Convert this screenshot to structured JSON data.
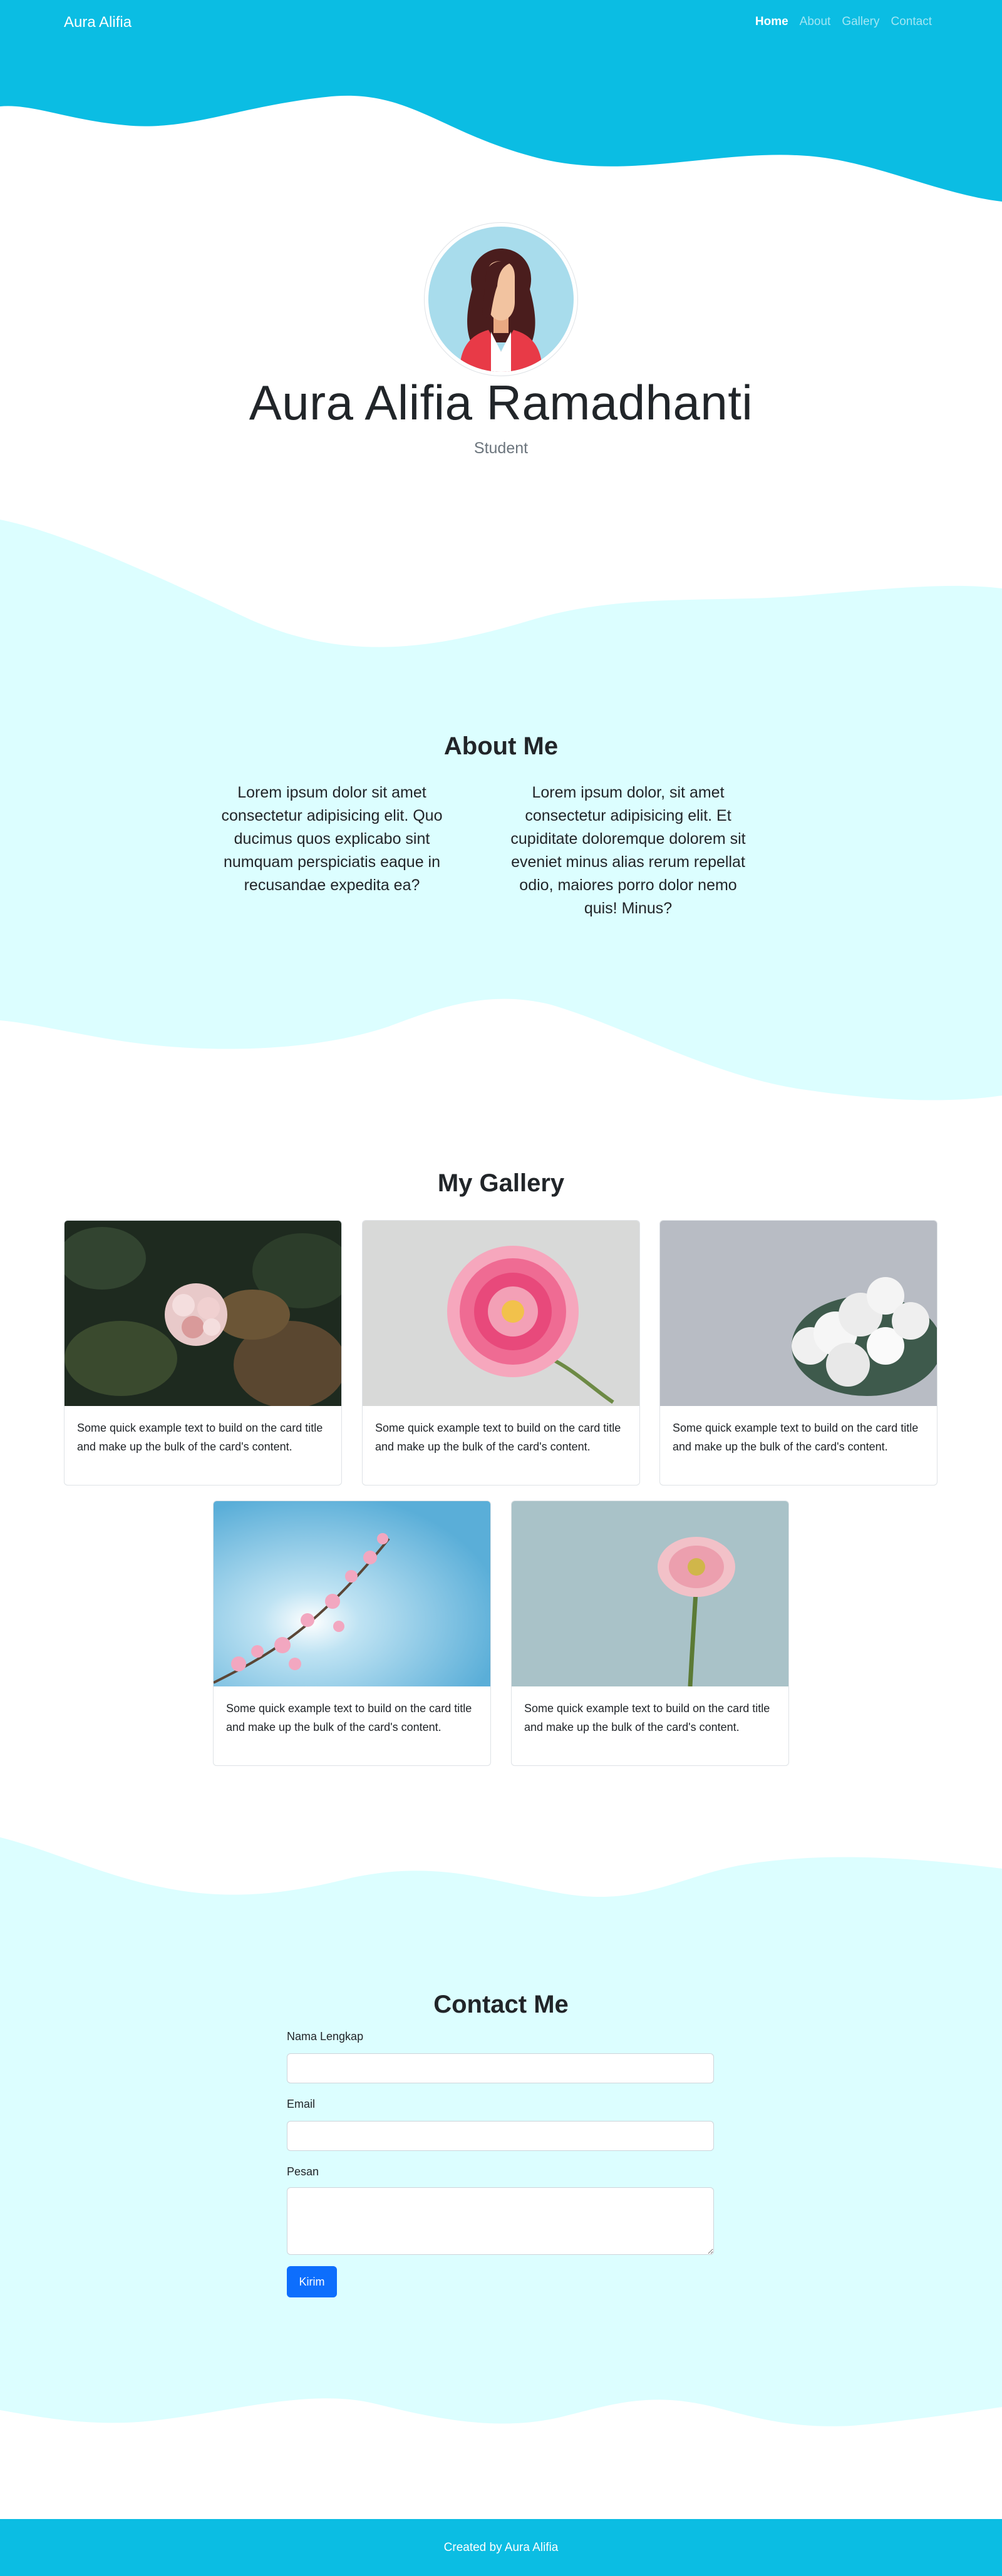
{
  "navbar": {
    "brand": "Aura Alifia",
    "links": [
      {
        "label": "Home",
        "active": true
      },
      {
        "label": "About",
        "active": false
      },
      {
        "label": "Gallery",
        "active": false
      },
      {
        "label": "Contact",
        "active": false
      }
    ]
  },
  "hero": {
    "name": "Aura Alifia Ramadhanti",
    "role": "Student"
  },
  "about": {
    "title": "About Me",
    "paragraphs": [
      "Lorem ipsum dolor sit amet consectetur adipisicing elit. Quo ducimus quos explicabo sint numquam perspiciatis eaque in recusandae expedita ea?",
      "Lorem ipsum dolor, sit amet consectetur adipisicing elit. Et cupiditate doloremque dolorem sit eveniet minus alias rerum repellat odio, maiores porro dolor nemo quis! Minus?"
    ]
  },
  "gallery": {
    "title": "My Gallery",
    "cards": [
      {
        "text": "Some quick example text to build on the card title and make up the bulk of the card's content."
      },
      {
        "text": "Some quick example text to build on the card title and make up the bulk of the card's content."
      },
      {
        "text": "Some quick example text to build on the card title and make up the bulk of the card's content."
      },
      {
        "text": "Some quick example text to build on the card title and make up the bulk of the card's content."
      },
      {
        "text": "Some quick example text to build on the card title and make up the bulk of the card's content."
      }
    ]
  },
  "contact": {
    "title": "Contact Me",
    "name_label": "Nama Lengkap",
    "email_label": "Email",
    "message_label": "Pesan",
    "submit_label": "Kirim"
  },
  "footer": {
    "text": "Created by Aura Alifia"
  },
  "colors": {
    "primary_cyan": "#0bbde3",
    "light_cyan": "#dcfeff",
    "button_blue": "#0d6efd"
  }
}
